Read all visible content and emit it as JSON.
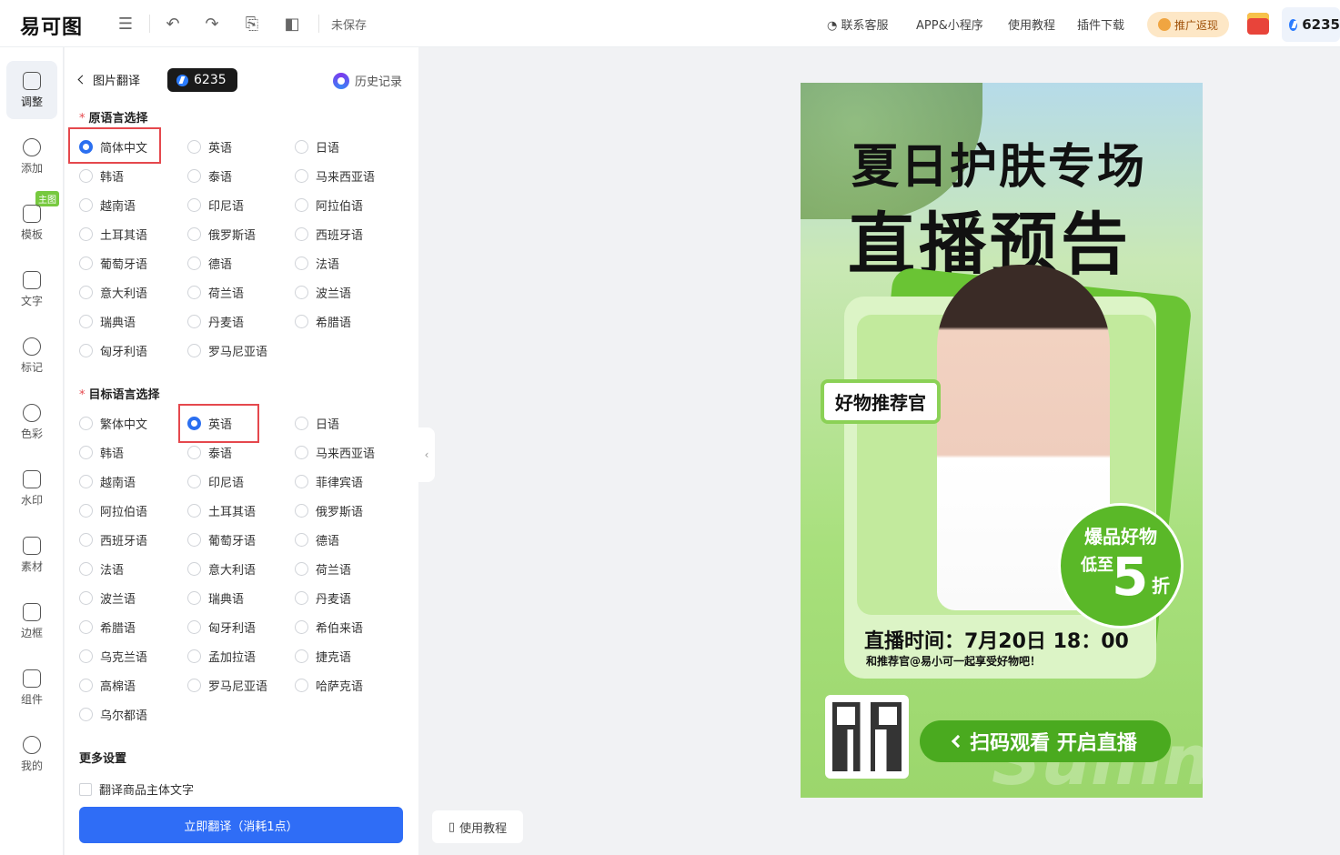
{
  "app": {
    "logo": "易可图",
    "status": "未保存"
  },
  "toolbar": {
    "icons": [
      "menu-icon",
      "undo-icon",
      "redo-icon",
      "replace-icon",
      "compare-icon"
    ]
  },
  "topnav": {
    "links": [
      "联系客服",
      "APP&小程序",
      "使用教程",
      "插件下载"
    ],
    "promo": "推广返现",
    "points": "6235"
  },
  "sidebar": {
    "items": [
      {
        "label": "调整",
        "icon": "sliders-icon"
      },
      {
        "label": "添加",
        "icon": "plus-circle-icon"
      },
      {
        "label": "模板",
        "icon": "grid-icon"
      },
      {
        "label": "文字",
        "icon": "text-icon"
      },
      {
        "label": "标记",
        "icon": "mark-icon"
      },
      {
        "label": "色彩",
        "icon": "palette-icon"
      },
      {
        "label": "水印",
        "icon": "stamp-icon"
      },
      {
        "label": "素材",
        "icon": "material-icon"
      },
      {
        "label": "边框",
        "icon": "border-icon"
      },
      {
        "label": "组件",
        "icon": "cube-icon"
      },
      {
        "label": "我的",
        "icon": "user-icon"
      }
    ],
    "template_tag": "主图"
  },
  "panel": {
    "back_label": "图片翻译",
    "points": "6235",
    "history": "历史记录",
    "source_title": "原语言选择",
    "source_selected": "简体中文",
    "source_langs": [
      "简体中文",
      "英语",
      "日语",
      "韩语",
      "泰语",
      "马来西亚语",
      "越南语",
      "印尼语",
      "阿拉伯语",
      "土耳其语",
      "俄罗斯语",
      "西班牙语",
      "葡萄牙语",
      "德语",
      "法语",
      "意大利语",
      "荷兰语",
      "波兰语",
      "瑞典语",
      "丹麦语",
      "希腊语",
      "匈牙利语",
      "罗马尼亚语"
    ],
    "target_title": "目标语言选择",
    "target_selected": "英语",
    "target_langs": [
      "繁体中文",
      "英语",
      "日语",
      "韩语",
      "泰语",
      "马来西亚语",
      "越南语",
      "印尼语",
      "菲律宾语",
      "阿拉伯语",
      "土耳其语",
      "俄罗斯语",
      "西班牙语",
      "葡萄牙语",
      "德语",
      "法语",
      "意大利语",
      "荷兰语",
      "波兰语",
      "瑞典语",
      "丹麦语",
      "希腊语",
      "匈牙利语",
      "希伯来语",
      "乌克兰语",
      "孟加拉语",
      "捷克语",
      "高棉语",
      "罗马尼亚语",
      "哈萨克语",
      "乌尔都语"
    ],
    "more_settings": "更多设置",
    "checkbox_label": "翻译商品主体文字",
    "translate_button": "立即翻译（消耗1点）"
  },
  "canvas": {
    "help_button": "使用教程",
    "poster": {
      "title1": "夏日护肤专场",
      "title2": "直播预告",
      "tag": "好物推荐官",
      "badge_line1": "爆品好物",
      "badge_low": "低至",
      "badge_num": "5",
      "badge_unit": "折",
      "time": "直播时间：7月20日 18：00",
      "subtitle": "和推荐官@易小可一起享受好物吧！",
      "cta": "扫码观看 开启直播",
      "watermark": "Summer"
    }
  }
}
